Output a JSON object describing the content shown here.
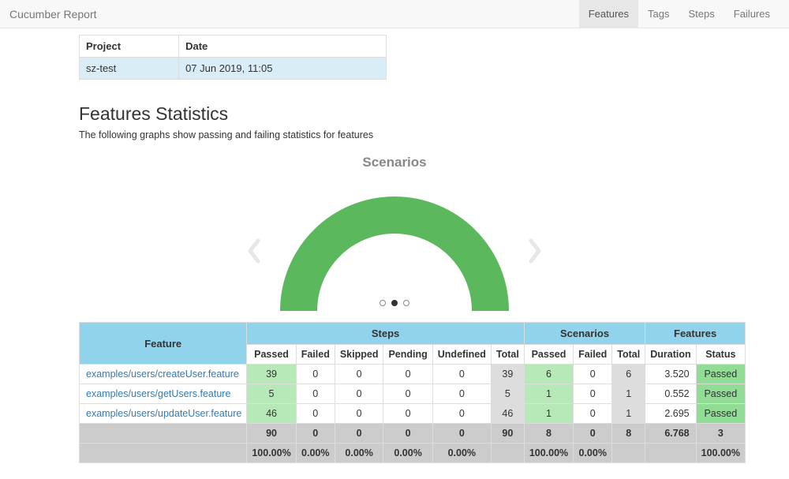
{
  "navbar": {
    "brand": "Cucumber Report",
    "items": [
      "Features",
      "Tags",
      "Steps",
      "Failures"
    ],
    "activeIndex": 0
  },
  "meta": {
    "headers": [
      "Project",
      "Date"
    ],
    "project": "sz-test",
    "date": "07 Jun 2019, 11:05"
  },
  "section": {
    "title": "Features Statistics",
    "subtitle": "The following graphs show passing and failing statistics for features"
  },
  "carousel": {
    "title": "Scenarios",
    "dots": 3,
    "activeDot": 1
  },
  "statsTable": {
    "groupHeaders": {
      "feature": "Feature",
      "steps": "Steps",
      "scenarios": "Scenarios",
      "features": "Features"
    },
    "subHeaders": {
      "passed": "Passed",
      "failed": "Failed",
      "skipped": "Skipped",
      "pending": "Pending",
      "undefined": "Undefined",
      "total": "Total",
      "duration": "Duration",
      "status": "Status"
    },
    "rows": [
      {
        "feature": "examples/users/createUser.feature",
        "stepsPassed": "39",
        "stepsFailed": "0",
        "stepsSkipped": "0",
        "stepsPending": "0",
        "stepsUndefined": "0",
        "stepsTotal": "39",
        "scenPassed": "6",
        "scenFailed": "0",
        "scenTotal": "6",
        "duration": "3.520",
        "status": "Passed"
      },
      {
        "feature": "examples/users/getUsers.feature",
        "stepsPassed": "5",
        "stepsFailed": "0",
        "stepsSkipped": "0",
        "stepsPending": "0",
        "stepsUndefined": "0",
        "stepsTotal": "5",
        "scenPassed": "1",
        "scenFailed": "0",
        "scenTotal": "1",
        "duration": "0.552",
        "status": "Passed"
      },
      {
        "feature": "examples/users/updateUser.feature",
        "stepsPassed": "46",
        "stepsFailed": "0",
        "stepsSkipped": "0",
        "stepsPending": "0",
        "stepsUndefined": "0",
        "stepsTotal": "46",
        "scenPassed": "1",
        "scenFailed": "0",
        "scenTotal": "1",
        "duration": "2.695",
        "status": "Passed"
      }
    ],
    "totals1": {
      "stepsPassed": "90",
      "stepsFailed": "0",
      "stepsSkipped": "0",
      "stepsPending": "0",
      "stepsUndefined": "0",
      "stepsTotal": "90",
      "scenPassed": "8",
      "scenFailed": "0",
      "scenTotal": "8",
      "duration": "6.768",
      "featuresTotal": "3"
    },
    "totals2": {
      "stepsPassed": "100.00%",
      "stepsFailed": "0.00%",
      "stepsSkipped": "0.00%",
      "stepsPending": "0.00%",
      "stepsUndefined": "0.00%",
      "scenPassed": "100.00%",
      "scenFailed": "0.00%",
      "featuresStatus": "100.00%"
    }
  }
}
